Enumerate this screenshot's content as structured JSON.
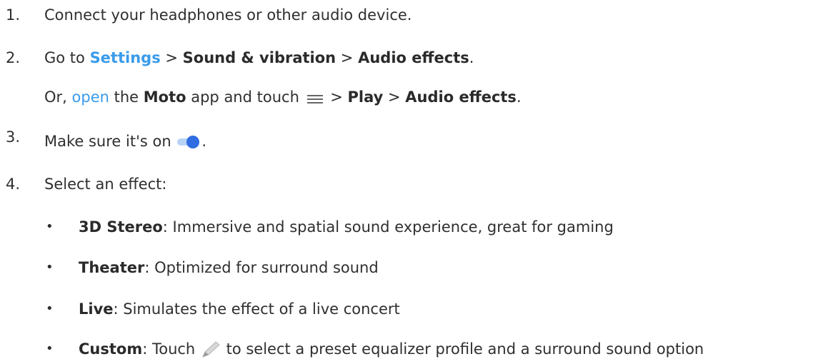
{
  "steps": [
    {
      "number": "1.",
      "text": "Connect your headphones or other audio device."
    },
    {
      "number": "2.",
      "prefix": "Go to ",
      "settings": "Settings",
      "sep1": " > ",
      "sound": "Sound & vibration",
      "sep2": " > ",
      "audio_effects": "Audio effects",
      "end": ".",
      "alt_or": "Or, ",
      "alt_open": "open",
      "alt_the": " the ",
      "alt_moto": "Moto",
      "alt_touch": " app and touch ",
      "menu_icon": "menu-icon",
      "alt_sep1": " > ",
      "alt_play": "Play",
      "alt_sep2": " > ",
      "alt_audio_effects": "Audio effects",
      "alt_end": "."
    },
    {
      "number": "3.",
      "text": "Make sure it's on ",
      "toggle_icon": "toggle-on-icon",
      "end": "."
    },
    {
      "number": "4.",
      "text": "Select an effect:"
    }
  ],
  "effects": [
    {
      "bullet": "•",
      "name": "3D Stereo",
      "desc": ": Immersive and spatial sound experience, great for gaming"
    },
    {
      "bullet": "•",
      "name": "Theater",
      "desc": ": Optimized for surround sound"
    },
    {
      "bullet": "•",
      "name": "Live",
      "desc": ": Simulates the effect of a live concert"
    },
    {
      "bullet": "•",
      "name": "Custom",
      "desc_before": ": Touch ",
      "pencil_icon": "pencil-icon",
      "desc_after": " to select a preset equalizer profile and a surround sound option"
    }
  ],
  "colors": {
    "text": "#2f2f2f",
    "link": "#3a9bea",
    "toggle_thumb": "#2f6de1",
    "toggle_track": "#b9d3f6"
  }
}
